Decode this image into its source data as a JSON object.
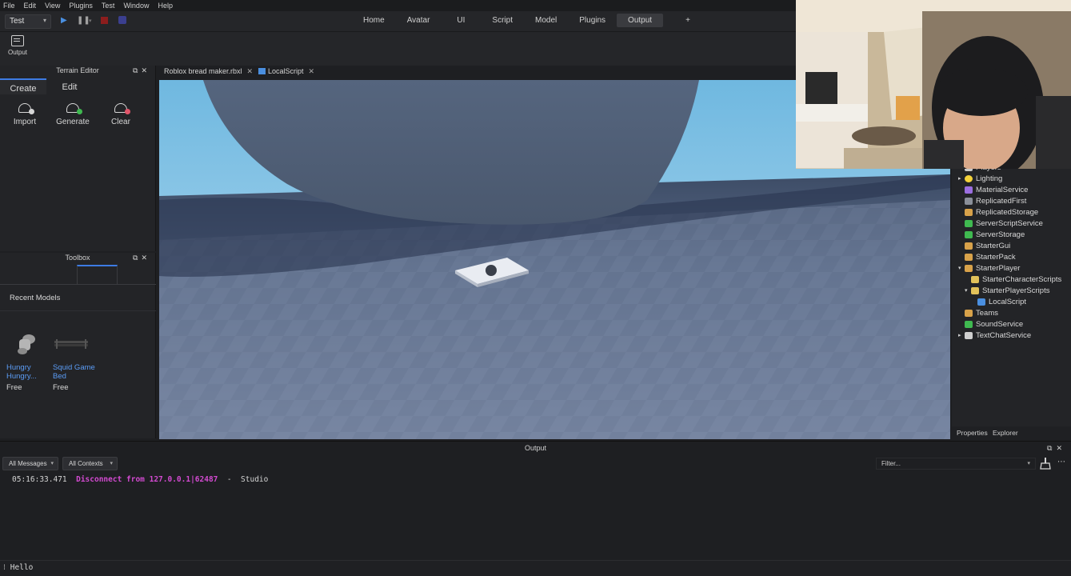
{
  "menubar": {
    "items": [
      "File",
      "Edit",
      "View",
      "Plugins",
      "Test",
      "Window",
      "Help"
    ]
  },
  "toolbar": {
    "mode": "Test",
    "tabs": [
      "Home",
      "Avatar",
      "UI",
      "Script",
      "Model",
      "Plugins",
      "Output",
      "+"
    ],
    "active_tab": "Output",
    "play_icon": "play-icon",
    "pause_icon": "pause-icon",
    "stop_icon": "stop-icon"
  },
  "ribbon": {
    "output_label": "Output"
  },
  "terrain_editor": {
    "title": "Terrain Editor",
    "tabs": [
      "Create",
      "Edit"
    ],
    "tools": [
      "Import",
      "Generate",
      "Clear"
    ]
  },
  "toolbox": {
    "title": "Toolbox",
    "recent_label": "Recent Models",
    "models": [
      {
        "name_line1": "Hungry",
        "name_line2": "Hungry...",
        "price": "Free"
      },
      {
        "name_line1": "Squid Game",
        "name_line2": "Bed",
        "price": "Free"
      }
    ]
  },
  "viewport": {
    "doc_tabs": [
      "Roblox bread maker.rbxl",
      "LocalScript"
    ]
  },
  "explorer": {
    "items": [
      {
        "label": "Players",
        "indent": 0,
        "arrow": "",
        "color": "#c8c8c8"
      },
      {
        "label": "Lighting",
        "indent": 0,
        "arrow": "▸",
        "color": "#f4d23b"
      },
      {
        "label": "MaterialService",
        "indent": 0,
        "arrow": "",
        "color": "#9b6ee0"
      },
      {
        "label": "ReplicatedFirst",
        "indent": 0,
        "arrow": "",
        "color": "#8a8f99"
      },
      {
        "label": "ReplicatedStorage",
        "indent": 0,
        "arrow": "",
        "color": "#d8a24a"
      },
      {
        "label": "ServerScriptService",
        "indent": 0,
        "arrow": "",
        "color": "#3fb950"
      },
      {
        "label": "ServerStorage",
        "indent": 0,
        "arrow": "",
        "color": "#3fb950"
      },
      {
        "label": "StarterGui",
        "indent": 0,
        "arrow": "",
        "color": "#d8a24a"
      },
      {
        "label": "StarterPack",
        "indent": 0,
        "arrow": "",
        "color": "#d8a24a"
      },
      {
        "label": "StarterPlayer",
        "indent": 0,
        "arrow": "▾",
        "color": "#d8a24a"
      },
      {
        "label": "StarterCharacterScripts",
        "indent": 1,
        "arrow": "",
        "color": "#e2c25a"
      },
      {
        "label": "StarterPlayerScripts",
        "indent": 1,
        "arrow": "▾",
        "color": "#e2c25a"
      },
      {
        "label": "LocalScript",
        "indent": 2,
        "arrow": "",
        "color": "#4a8fe0"
      },
      {
        "label": "Teams",
        "indent": 0,
        "arrow": "",
        "color": "#d8a24a"
      },
      {
        "label": "SoundService",
        "indent": 0,
        "arrow": "",
        "color": "#3fb950"
      },
      {
        "label": "TextChatService",
        "indent": 0,
        "arrow": "▸",
        "color": "#cfcfcf"
      }
    ],
    "tabs": [
      "Properties",
      "Explorer"
    ]
  },
  "output": {
    "title": "Output",
    "messages_filter": "All Messages",
    "contexts_filter": "All Contexts",
    "filter_placeholder": "Filter...",
    "log": {
      "timestamp": "05:16:33.471",
      "message": "Disconnect from 127.0.0.1|62487",
      "separator": "-",
      "source": "Studio"
    }
  },
  "command_bar": {
    "text": "Hello"
  },
  "colors": {
    "accent": "#3d7be3",
    "link": "#5b9cf5",
    "log_highlight": "#d34ad1"
  }
}
